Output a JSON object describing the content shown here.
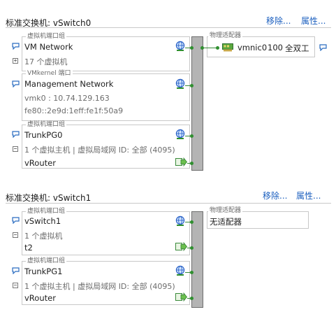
{
  "switches": [
    {
      "title": "标准交换机: vSwitch0",
      "actions": {
        "remove": "移除...",
        "properties": "属性..."
      },
      "adapter_section_label": "物理适配器",
      "adapter": {
        "name": "vmnic0",
        "speed": "100",
        "duplex": "全双工"
      },
      "groups": [
        {
          "type_label": "虚拟机端口组",
          "name": "VM Network",
          "detail": "17 个虚拟机",
          "expander": "+"
        },
        {
          "type_label": "VMkernel 端口",
          "name": "Management Network",
          "ipv4": "vmk0 : 10.74.129.163",
          "ipv6": "fe80::2e9d:1eff:fe1f:50a9"
        },
        {
          "type_label": "虚拟机端口组",
          "name": "TrunkPG0",
          "detail": "1 个虚拟主机 | 虚拟局域网 ID: 全部 (4095)",
          "expander": "−",
          "vm": "vRouter"
        }
      ]
    },
    {
      "title": "标准交换机: vSwitch1",
      "actions": {
        "remove": "移除...",
        "properties": "属性..."
      },
      "adapter_section_label": "物理适配器",
      "adapter_empty": "无适配器",
      "groups": [
        {
          "type_label": "虚拟机端口组",
          "name": "vSwitch1",
          "detail": "1 个虚拟机",
          "expander": "−",
          "vm": "t2"
        },
        {
          "type_label": "虚拟机端口组",
          "name": "TrunkPG1",
          "detail": "1 个虚拟主机 | 虚拟局域网 ID: 全部 (4095)",
          "expander": "−",
          "vm": "vRouter"
        }
      ]
    }
  ],
  "colors": {
    "link": "#1b5fbf",
    "port_green": "#2f8f2f",
    "spine": "#b4b4b4",
    "nic": "#4a9a3a"
  },
  "icons": [
    "speech-bubble-icon",
    "network-globe-icon",
    "vm-adapter-icon",
    "nic-card-icon",
    "expand-collapse-icon"
  ]
}
